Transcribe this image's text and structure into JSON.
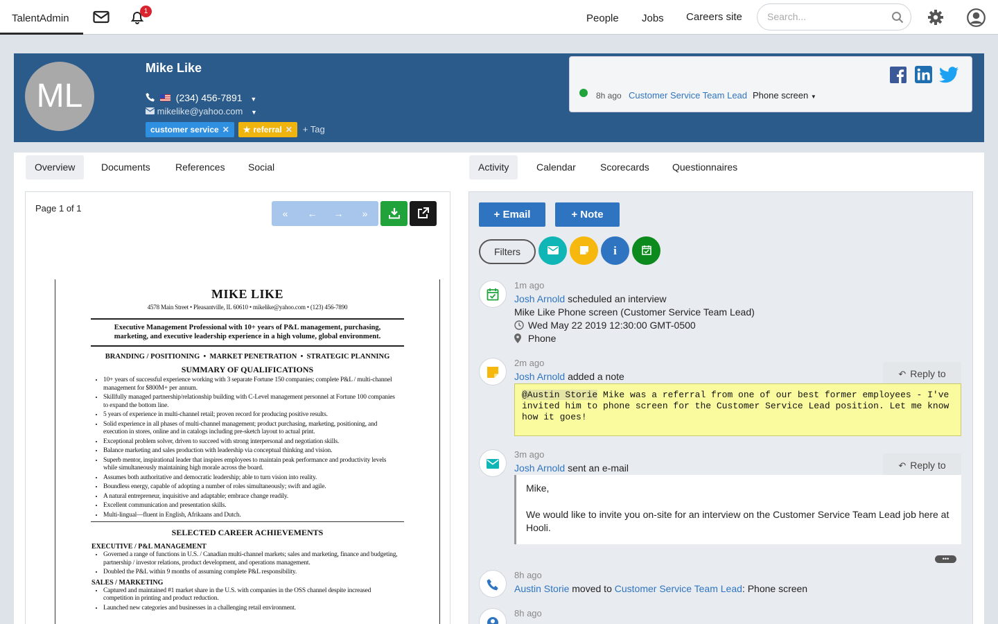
{
  "topbar": {
    "brand": "TalentAdmin",
    "notification_count": "1",
    "nav": [
      "People",
      "Jobs",
      "Careers site"
    ],
    "search_placeholder": "Search..."
  },
  "candidate": {
    "initials": "ML",
    "name": "Mike Like",
    "phone": "(234) 456-7891",
    "email": "mikelike@yahoo.com",
    "tags": [
      {
        "label": "customer service",
        "color": "#2f8fe0"
      },
      {
        "label": "referral",
        "color": "#f0b40f"
      }
    ],
    "add_tag": "+ Tag"
  },
  "status": {
    "time": "8h ago",
    "job": "Customer Service Team Lead",
    "stage": "Phone screen",
    "indicator_color": "#1fa33a",
    "social": [
      "facebook-icon",
      "linkedin-icon",
      "twitter-icon"
    ]
  },
  "left_tabs": [
    "Overview",
    "Documents",
    "References",
    "Social"
  ],
  "right_tabs": [
    "Activity",
    "Calendar",
    "Scorecards",
    "Questionnaires"
  ],
  "doc": {
    "page_label": "Page 1 of 1",
    "resume": {
      "name": "MIKE LIKE",
      "contact": "4578 Main Street • Pleasantville, IL 60610 • mikelike@yahoo.com • (123) 456-7890",
      "summary": "Executive Management Professional with 10+ years of P&L management, purchasing, marketing, and executive leadership experience in a high volume, global environment.",
      "keywords": "BRANDING / POSITIONING  •  MARKET PENETRATION  •  STRATEGIC PLANNING",
      "qual_heading": "SUMMARY OF QUALIFICATIONS",
      "qualifications": [
        "10+ years of successful experience working with 3 separate Fortune 150 companies; complete P&L / multi-channel management for $800M+ per annum.",
        "Skillfully managed partnership/relationship building with C-Level management personnel at Fortune 100 companies to expand the bottom line.",
        "5 years of experience in multi-channel retail; proven record for producing positive results.",
        "Solid experience in all phases of multi-channel management; product purchasing, marketing, positioning, and execution in stores, online and in catalogs including pre-sketch layout to actual print.",
        "Exceptional problem solver, driven to succeed with strong interpersonal and negotiation skills.",
        "Balance marketing and sales production with leadership via conceptual thinking and vision.",
        "Superb mentor, inspirational leader that inspires employees to maintain peak performance and productivity levels while simultaneously maintaining high morale across the board.",
        "Assumes both authoritative and democratic leadership; able to turn vision into reality.",
        "Boundless energy, capable of adopting a number of roles simultaneously; swift and agile.",
        "A natural entrepreneur, inquisitive and adaptable; embrace change readily.",
        "Excellent communication and presentation skills.",
        "Multi-lingual—fluent in English, Afrikaans and Dutch."
      ],
      "ach_heading": "SELECTED CAREER ACHIEVEMENTS",
      "exec_heading": "EXECUTIVE / P&L MANAGEMENT",
      "exec_items": [
        "Governed a range of functions in U.S. / Canadian multi-channel markets; sales and marketing, finance and budgeting, partnership / investor relations, product development, and operations management.",
        "Doubled the P&L within 9 months of assuming complete P&L responsibility."
      ],
      "sales_heading": "SALES / MARKETING",
      "sales_items": [
        "Captured and maintained #1 market share in the U.S. with companies in the OSS channel despite increased competition in printing and product reduction.",
        "Launched new categories and businesses in a challenging retail environment."
      ]
    }
  },
  "activity": {
    "email_btn": "+ Email",
    "note_btn": "+ Note",
    "filters": "Filters",
    "items": [
      {
        "ago": "1m ago",
        "actor": "Josh Arnold",
        "action": "scheduled an interview",
        "title": "Mike Like Phone screen (Customer Service Team Lead)",
        "when": "Wed May 22 2019 12:30:00 GMT-0500",
        "where": "Phone"
      },
      {
        "ago": "2m ago",
        "actor": "Josh Arnold",
        "action": "added a note",
        "reply": "Reply to",
        "mention": "@Austin Storie",
        "note": " Mike was a referral from one of our best former employees - I've invited him to phone screen for the Customer Service Lead position. Let me know how it goes!"
      },
      {
        "ago": "3m ago",
        "actor": "Josh Arnold",
        "action": "sent an e-mail",
        "reply": "Reply to",
        "greeting": "Mike,",
        "body": "We would like to invite you on-site for an interview on the Customer Service Team Lead job here at Hooli.",
        "more": "•••"
      },
      {
        "ago": "8h ago",
        "actor": "Austin Storie",
        "action": "moved to",
        "job": "Customer Service Team Lead",
        "stage": ": Phone screen"
      },
      {
        "ago": "8h ago"
      }
    ]
  }
}
